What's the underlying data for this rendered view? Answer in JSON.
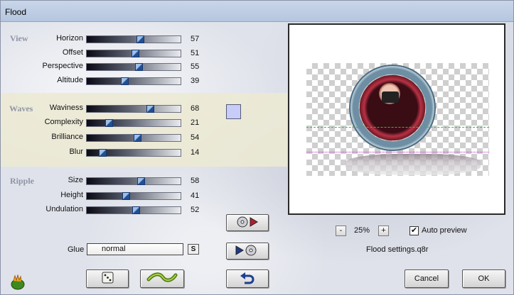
{
  "window": {
    "title": "Flood"
  },
  "sections": {
    "view": "View",
    "waves": "Waves",
    "ripple": "Ripple"
  },
  "sliders": [
    {
      "key": "horizon",
      "label": "Horizon",
      "value": "57",
      "fraction": 0.57
    },
    {
      "key": "offset",
      "label": "Offset",
      "value": "51",
      "fraction": 0.51
    },
    {
      "key": "perspective",
      "label": "Perspective",
      "value": "55",
      "fraction": 0.55
    },
    {
      "key": "altitude",
      "label": "Altitude",
      "value": "39",
      "fraction": 0.39
    },
    {
      "key": "waviness",
      "label": "Waviness",
      "value": "68",
      "fraction": 0.68
    },
    {
      "key": "complexity",
      "label": "Complexity",
      "value": "21",
      "fraction": 0.21
    },
    {
      "key": "brilliance",
      "label": "Brilliance",
      "value": "54",
      "fraction": 0.54
    },
    {
      "key": "blur",
      "label": "Blur",
      "value": "14",
      "fraction": 0.14
    },
    {
      "key": "size",
      "label": "Size",
      "value": "58",
      "fraction": 0.58
    },
    {
      "key": "height",
      "label": "Height",
      "value": "41",
      "fraction": 0.41
    },
    {
      "key": "undulation",
      "label": "Undulation",
      "value": "52",
      "fraction": 0.52
    }
  ],
  "color_swatch": "#c8ccf8",
  "glue": {
    "label": "Glue",
    "value": "normal",
    "s_button": "S"
  },
  "preview": {
    "zoom_minus": "-",
    "zoom_value": "25%",
    "zoom_plus": "+",
    "auto_preview_label": "Auto preview",
    "auto_preview_checked": "✔",
    "settings_file": "Flood settings.q8r"
  },
  "buttons": {
    "cancel": "Cancel",
    "ok": "OK"
  }
}
